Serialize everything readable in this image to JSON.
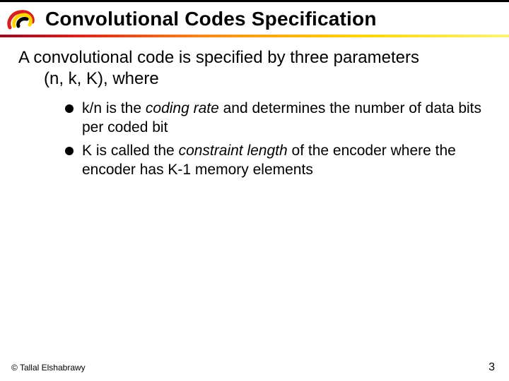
{
  "header": {
    "title": "Convolutional Codes Specification"
  },
  "body": {
    "lead_line1": "A convolutional code is specified by three parameters",
    "lead_line2": "(n, k, K), where",
    "bullets": [
      {
        "pre": "k/n is the ",
        "em": "coding rate",
        "post": " and determines the number of data bits per coded bit"
      },
      {
        "pre": "K is called the ",
        "em": "constraint length",
        "post": " of the encoder where the encoder has K-1 memory elements"
      }
    ]
  },
  "footer": {
    "copyright": "© Tallal Elshabrawy",
    "page": "3"
  }
}
